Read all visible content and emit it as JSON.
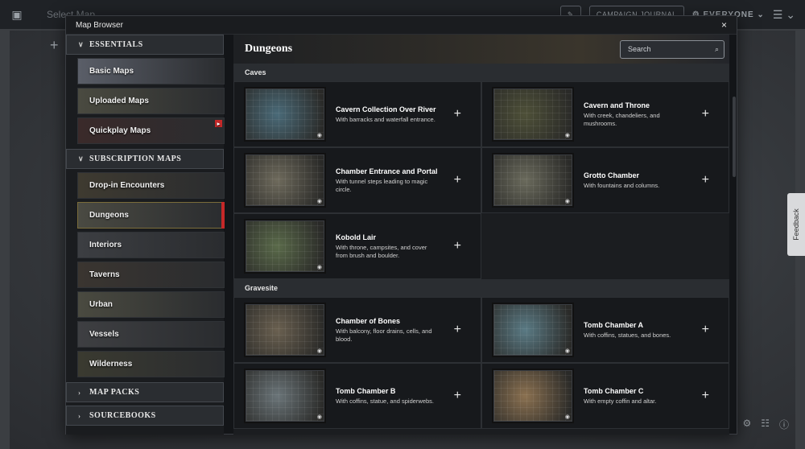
{
  "app": {
    "select_map": "Select Map",
    "campaign_journal": "CAMPAIGN JOURNAL",
    "everyone": "EVERYONE",
    "feedback": "Feedback"
  },
  "modal": {
    "title": "Map Browser",
    "close": "×"
  },
  "sidebar": {
    "essentials": {
      "label": "ESSENTIALS",
      "items": [
        {
          "label": "Basic Maps",
          "color": "#5a5e68"
        },
        {
          "label": "Uploaded Maps",
          "color": "#4a4a40"
        },
        {
          "label": "Quickplay Maps",
          "color": "#3a2a2a"
        }
      ]
    },
    "subscription": {
      "label": "SUBSCRIPTION MAPS",
      "items": [
        {
          "label": "Drop-in Encounters",
          "color": "#3e3a30"
        },
        {
          "label": "Dungeons",
          "color": "#4a4a42"
        },
        {
          "label": "Interiors",
          "color": "#3c3e42"
        },
        {
          "label": "Taverns",
          "color": "#3a3530"
        },
        {
          "label": "Urban",
          "color": "#4a4a40"
        },
        {
          "label": "Vessels",
          "color": "#3e3f42"
        },
        {
          "label": "Wilderness",
          "color": "#3a3a30"
        }
      ]
    },
    "map_packs": "MAP PACKS",
    "sourcebooks": "SOURCEBOOKS"
  },
  "main": {
    "title": "Dungeons",
    "search_placeholder": "Search",
    "categories": [
      {
        "name": "Caves",
        "maps": [
          {
            "title": "Cavern Collection Over River",
            "desc": "With barracks and waterfall entrance.",
            "color": "#4a6a78"
          },
          {
            "title": "Cavern and Throne",
            "desc": "With creek, chandeliers, and mushrooms.",
            "color": "#4e5038"
          },
          {
            "title": "Chamber Entrance and Portal",
            "desc": "With tunnel steps leading to magic circle.",
            "color": "#6e6a5c"
          },
          {
            "title": "Grotto Chamber",
            "desc": "With fountains and columns.",
            "color": "#6a6a5c"
          },
          {
            "title": "Kobold Lair",
            "desc": "With throne, campsites, and cover from brush and boulder.",
            "color": "#5a6a4a"
          }
        ]
      },
      {
        "name": "Gravesite",
        "maps": [
          {
            "title": "Chamber of Bones",
            "desc": "With balcony, floor drains, cells, and blood.",
            "color": "#6a6050"
          },
          {
            "title": "Tomb Chamber A",
            "desc": "With coffins, statues, and bones.",
            "color": "#5a7a84"
          },
          {
            "title": "Tomb Chamber B",
            "desc": "With coffins, statue, and spiderwebs.",
            "color": "#6a7478"
          },
          {
            "title": "Tomb Chamber C",
            "desc": "With empty coffin and altar.",
            "color": "#8a7050"
          }
        ]
      }
    ]
  }
}
